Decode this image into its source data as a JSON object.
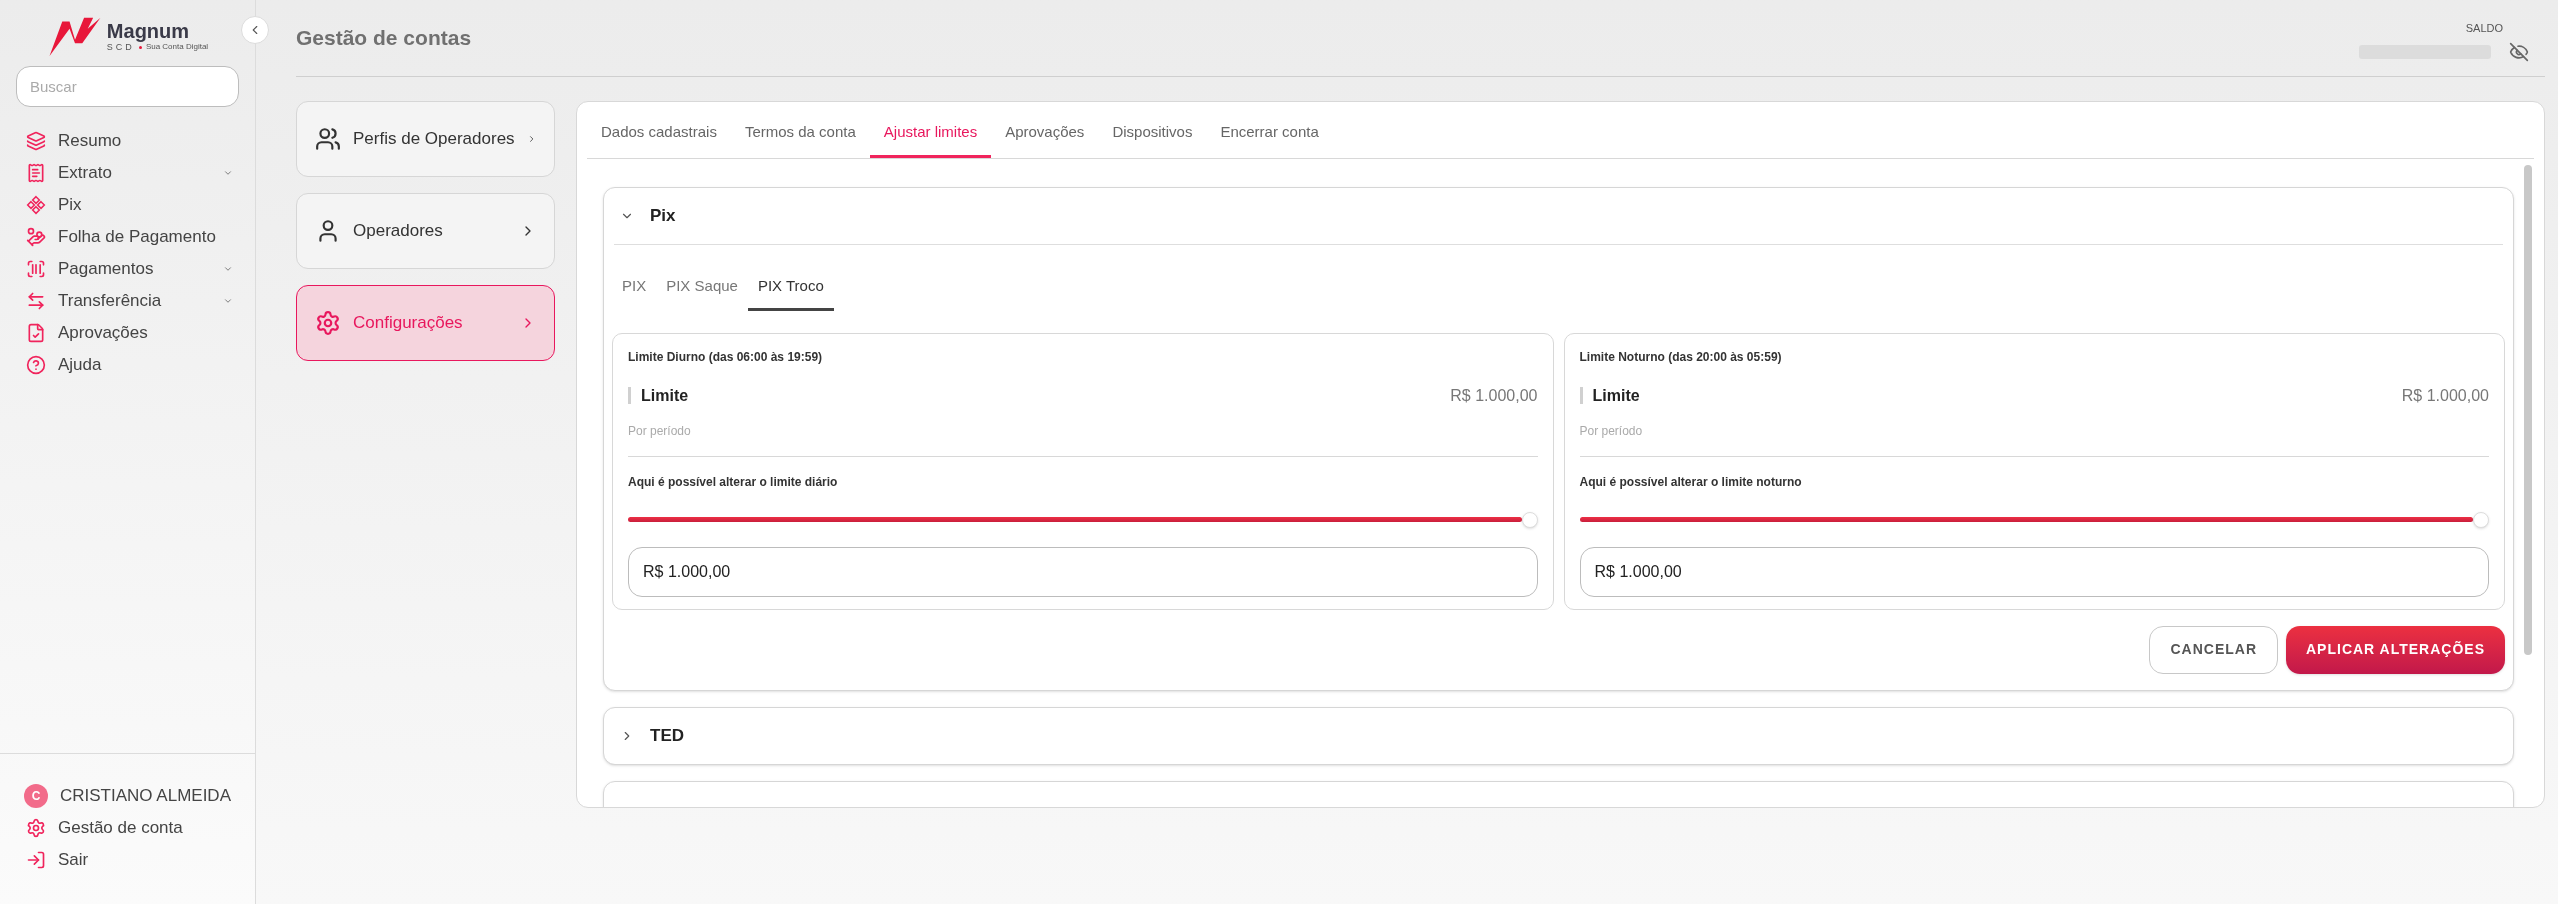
{
  "sidebar": {
    "logo": {
      "name": "Magnum",
      "sub": "SCD",
      "tagline": "Sua Conta Digital"
    },
    "search": {
      "placeholder": "Buscar"
    },
    "items": [
      {
        "label": "Resumo",
        "expandable": false
      },
      {
        "label": "Extrato",
        "expandable": true
      },
      {
        "label": "Pix",
        "expandable": false
      },
      {
        "label": "Folha de Pagamento",
        "expandable": false
      },
      {
        "label": "Pagamentos",
        "expandable": true
      },
      {
        "label": "Transferência",
        "expandable": true
      },
      {
        "label": "Aprovações",
        "expandable": false
      },
      {
        "label": "Ajuda",
        "expandable": false
      }
    ],
    "user": {
      "initial": "C",
      "name": "CRISTIANO ALMEIDA"
    },
    "footer_items": [
      {
        "label": "Gestão de conta"
      },
      {
        "label": "Sair"
      }
    ]
  },
  "header": {
    "title": "Gestão de contas",
    "balance_label": "SALDO"
  },
  "menu_cards": [
    {
      "label": "Perfis de Operadores",
      "selected": false
    },
    {
      "label": "Operadores",
      "selected": false
    },
    {
      "label": "Configurações",
      "selected": true
    }
  ],
  "tabs": [
    {
      "label": "Dados cadastrais",
      "selected": false
    },
    {
      "label": "Termos da conta",
      "selected": false
    },
    {
      "label": "Ajustar limites",
      "selected": true
    },
    {
      "label": "Aprovações",
      "selected": false
    },
    {
      "label": "Dispositivos",
      "selected": false
    },
    {
      "label": "Encerrar conta",
      "selected": false
    }
  ],
  "sections": [
    {
      "title": "Pix",
      "expanded": true,
      "subtabs": [
        {
          "label": "PIX",
          "selected": false
        },
        {
          "label": "PIX Saque",
          "selected": false
        },
        {
          "label": "PIX Troco",
          "selected": true
        }
      ],
      "limits": [
        {
          "heading": "Limite Diurno (das 06:00 às 19:59)",
          "label": "Limite",
          "amount": "R$ 1.000,00",
          "period": "Por período",
          "hint": "Aqui é possível alterar o limite diário",
          "level": 1,
          "value": "R$ 1.000,00"
        },
        {
          "heading": "Limite Noturno (das 20:00 às 05:59)",
          "label": "Limite",
          "amount": "R$ 1.000,00",
          "period": "Por período",
          "hint": "Aqui é possível alterar o limite noturno",
          "level": 1,
          "value": "R$ 1.000,00"
        }
      ],
      "buttons": [
        {
          "label": "CANCELAR",
          "kind": "secondary"
        },
        {
          "label": "APLICAR ALTERAÇÕES",
          "kind": "primary"
        }
      ]
    },
    {
      "title": "TED",
      "expanded": false
    },
    {
      "expanded": false
    }
  ]
}
